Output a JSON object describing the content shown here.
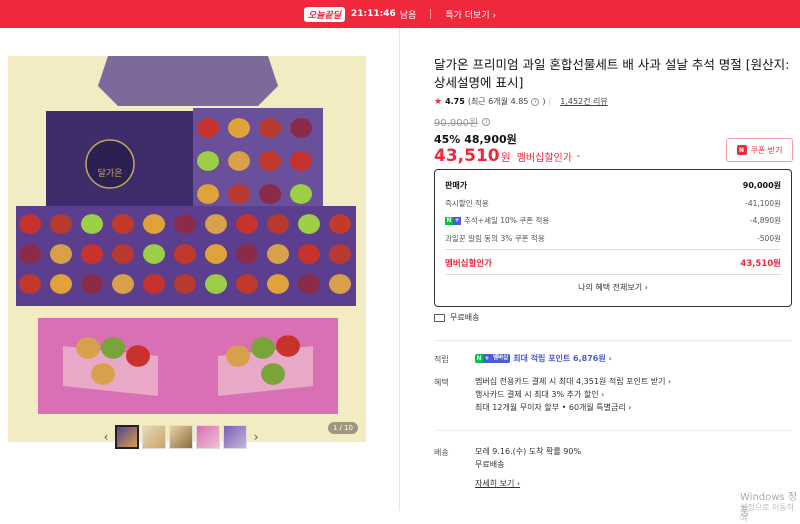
{
  "topbar": {
    "brand": "오늘끝딜",
    "timer": "21:11:46",
    "timer_suffix": "남음",
    "more": "특가 더보기 ›"
  },
  "gallery": {
    "counter": "1 / 10",
    "box_label": "달가온",
    "thumb_count": 5
  },
  "product": {
    "title": "달가온 프리미엄 과일 혼합선물세트 배 사과 설날 추석 명절 [원산지: 상세설명에 표시]",
    "rating": "4.75",
    "rating_recent": "(최근 6개월 4.85",
    "review_count": "1,452건 리뷰",
    "original_price": "90,000원",
    "discount_pct": "45%",
    "sale_price": "48,900원",
    "member_price": "43,510",
    "member_won": "원",
    "member_label": "멤버십할인가",
    "coupon_label": "쿠폰 받기"
  },
  "pricebox": {
    "list_label": "판매가",
    "list_value": "90,000원",
    "rows": [
      {
        "label": "즉시할인 적용",
        "value": "-41,100원"
      },
      {
        "label": "추석+세일 10% 쿠폰 적용",
        "value": "-4,890원"
      },
      {
        "label": "과일꾼 알림 동의 3% 쿠폰 적용",
        "value": "-500원"
      }
    ],
    "member_label": "멤버십할인가",
    "member_value": "43,510원",
    "all_benefits": "나의 혜택 전체보기 ›"
  },
  "shipping_free": "무료배송",
  "points": {
    "label": "적립",
    "badge": "멤버십",
    "text": "최대 적립 포인트 6,876원 ›"
  },
  "benefits": {
    "label": "혜택",
    "lines": [
      "멤버십 전용카드 결제 시 최대 4,351원 적립 포인트 받기 ›",
      "행사카드 결제 시 최대 3% 추가 할인 ›",
      "최대 12개월 무이자 할부 • 60개월 특별금리 ›"
    ]
  },
  "delivery": {
    "label": "배송",
    "eta": "모레 9.16.(수) 도착 확률 90%",
    "fee": "무료배송",
    "detail": "자세히 보기 ›"
  },
  "watermark": {
    "line1": "Windows 정품",
    "line2": "설정으로 이동하여"
  },
  "colors": {
    "accent": "#f0283c",
    "point_blue": "#4a5cd6",
    "naver_green": "#00c73c"
  }
}
